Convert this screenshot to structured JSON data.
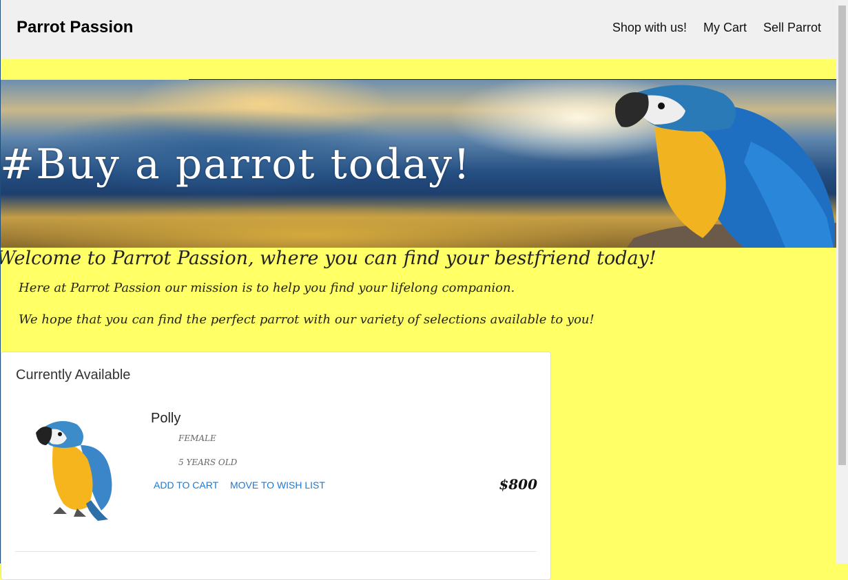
{
  "navbar": {
    "brand": "Parrot Passion",
    "links": [
      "Shop with us!",
      "My Cart",
      "Sell Parrot"
    ]
  },
  "banner": {
    "hashtag_text": "#Buy a parrot today!"
  },
  "intro": {
    "heading": "Welcome to Parrot Passion, where you can find your bestfriend today!",
    "paragraph_1": "Here at Parrot Passion our mission is to help you find your lifelong companion.",
    "paragraph_2": "We hope that you can find the perfect parrot with our variety of selections available to you!"
  },
  "listing": {
    "title": "Currently Available",
    "items": [
      {
        "name": "Polly",
        "gender": "FEMALE",
        "age": "5 YEARS OLD",
        "add_to_cart": "ADD TO CART",
        "move_to_wishlist": "MOVE TO WISH LIST",
        "price": "$800"
      }
    ]
  },
  "colors": {
    "page_background": "#ffff66",
    "navbar_background": "#f0f0f0",
    "link_blue": "#1f78d1"
  },
  "icons": {
    "banner_image": "macaw-on-sky-banner",
    "product_image": "blue-and-gold-macaw"
  }
}
